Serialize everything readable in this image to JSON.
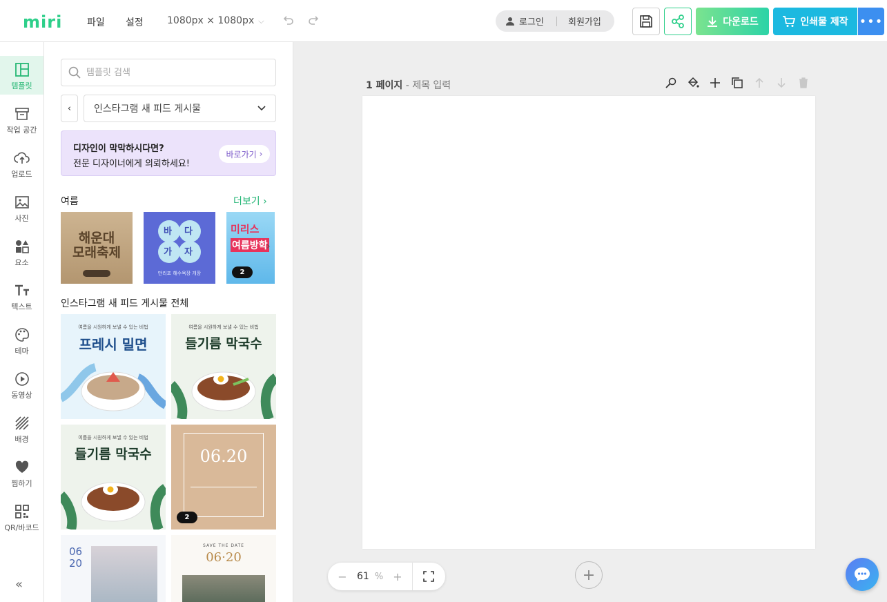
{
  "header": {
    "logo": "miri",
    "menu": [
      "파일",
      "설정"
    ],
    "size_label": "1080px × 1080px",
    "login_label": "로그인",
    "signup_label": "회원가입",
    "download_label": "다운로드",
    "print_label": "인쇄물 제작"
  },
  "rail": {
    "items": [
      {
        "label": "템플릿",
        "icon": "template-icon"
      },
      {
        "label": "작업 공간",
        "icon": "archive-icon"
      },
      {
        "label": "업로드",
        "icon": "upload-cloud-icon"
      },
      {
        "label": "사진",
        "icon": "photo-icon"
      },
      {
        "label": "요소",
        "icon": "shapes-icon"
      },
      {
        "label": "텍스트",
        "icon": "text-icon"
      },
      {
        "label": "테마",
        "icon": "palette-icon"
      },
      {
        "label": "동영상",
        "icon": "play-icon"
      },
      {
        "label": "배경",
        "icon": "background-icon"
      },
      {
        "label": "찜하기",
        "icon": "heart-icon"
      },
      {
        "label": "QR/바코드",
        "icon": "qr-icon"
      }
    ]
  },
  "panel": {
    "search_placeholder": "템플릿 검색",
    "category": "인스타그램 새 피드 게시물",
    "banner_line1": "디자인이 막막하시다면?",
    "banner_line2": "전문 디자이너에게 의뢰하세요!",
    "banner_button": "바로가기",
    "section1_title": "여름",
    "more_label": "더보기",
    "section2_title": "인스타그램 새 피드 게시물 전체",
    "summer_thumbs": [
      {
        "line1": "해운대",
        "line2": "모래축제"
      },
      {
        "letters": [
          "바",
          "다",
          "가",
          "자"
        ],
        "caption": "만리포 해수욕장 개장"
      },
      {
        "line1": "미리스",
        "line2": "여름방학",
        "badge": "2"
      }
    ],
    "grid_thumbs": [
      {
        "title": "프레시 밀면",
        "tagline": "여름을 시원하게 보낼 수 있는 비법"
      },
      {
        "title": "들기름 막국수",
        "tagline": "여름을 시원하게 보낼 수 있는 비법"
      },
      {
        "title": "들기름 막국수",
        "tagline": "여름을 시원하게 보낼 수 있는 비법"
      },
      {
        "title": "06.20",
        "badge": "2"
      },
      {
        "title": "06\n20"
      },
      {
        "title": "06·20",
        "tagline": "SAVE THE DATE"
      }
    ]
  },
  "canvas": {
    "page_number": "1 페이지",
    "page_title_placeholder": "- 제목 입력",
    "zoom_value": "61",
    "zoom_unit": "%"
  },
  "colors": {
    "brand_green": "#2ecf8a",
    "print_blue": "#1cb9e0",
    "more_blue": "#3c8ff0"
  }
}
